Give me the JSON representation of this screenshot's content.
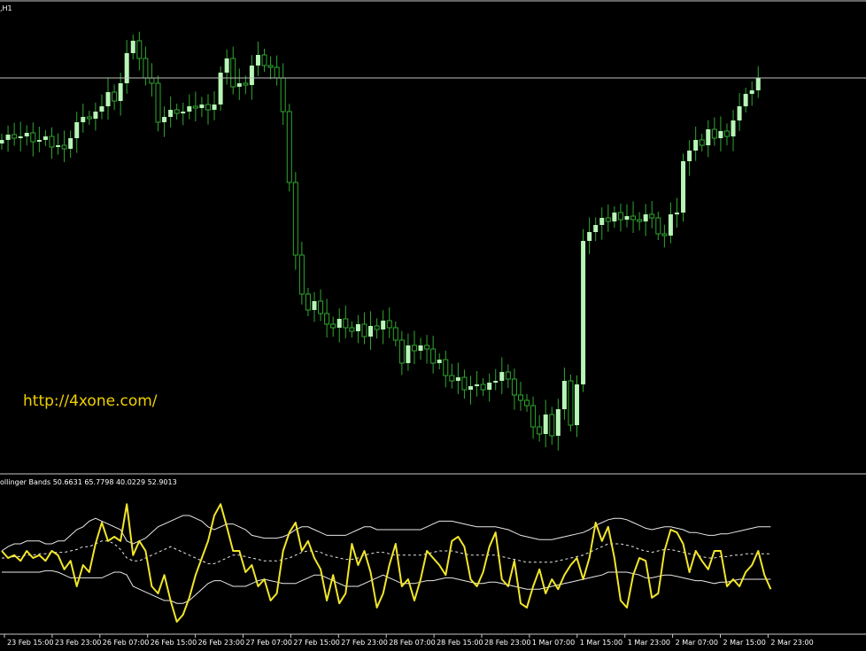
{
  "window": {
    "symbol_label": ",H1",
    "url_text": "http://4xone.com/"
  },
  "colors": {
    "background": "#000000",
    "frame": "#c8c8c8",
    "bull_body": "#b8f5b8",
    "wick": "#2fa82f",
    "price_line": "#c0c0c0",
    "indicator_line": "#f2e62a",
    "band_line": "#e8e8e8",
    "url": "#f0d000"
  },
  "chart_data": [
    {
      "type": "candlestick",
      "timeframe": "H1",
      "y_reference": 1.0,
      "y_range": [
        0.0,
        1.0
      ],
      "closes": [
        0.36,
        0.39,
        0.37,
        0.38,
        0.4,
        0.35,
        0.36,
        0.38,
        0.32,
        0.33,
        0.31,
        0.37,
        0.46,
        0.49,
        0.48,
        0.52,
        0.55,
        0.63,
        0.58,
        0.68,
        0.85,
        0.92,
        0.82,
        0.71,
        0.68,
        0.46,
        0.49,
        0.53,
        0.51,
        0.52,
        0.55,
        0.54,
        0.56,
        0.53,
        0.56,
        0.74,
        0.82,
        0.66,
        0.68,
        0.67,
        0.78,
        0.84,
        0.78,
        0.77,
        0.71,
        0.52,
        0.12,
        -0.29,
        -0.51,
        -0.6,
        -0.55,
        -0.62,
        -0.68,
        -0.7,
        -0.65,
        -0.7,
        -0.72,
        -0.68,
        -0.75,
        -0.69,
        -0.71,
        -0.66,
        -0.7,
        -0.77,
        -0.9,
        -0.8,
        -0.83,
        -0.8,
        -0.82,
        -0.9,
        -0.88,
        -0.97,
        -1.0,
        -0.98,
        -1.05,
        -1.03,
        -1.02,
        -1.05,
        -1.01,
        -1.0,
        -0.95,
        -0.99,
        -1.08,
        -1.11,
        -1.14,
        -1.26,
        -1.3,
        -1.19,
        -1.31,
        -1.16,
        -1.0,
        -1.25,
        -1.02,
        -0.21,
        -0.16,
        -0.12,
        -0.08,
        -0.1,
        -0.05,
        -0.09,
        -0.07,
        -0.09,
        -0.1,
        -0.06,
        -0.08,
        -0.17,
        -0.18,
        -0.06,
        -0.05,
        0.24,
        0.3,
        0.36,
        0.33,
        0.42,
        0.37,
        0.41,
        0.38,
        0.47,
        0.55,
        0.62,
        0.64,
        0.71
      ],
      "price_line": 0.71,
      "watermark": "http://4xone.com/"
    },
    {
      "type": "line",
      "indicator": "Bollinger Bands",
      "header_text": "ollinger Bands 50.6631 65.7798 40.0229 52.9013",
      "x_tick_labels": [
        "23 Feb 15:00",
        "23 Feb 23:00",
        "26 Feb 07:00",
        "26 Feb 15:00",
        "26 Feb 23:00",
        "27 Feb 07:00",
        "27 Feb 15:00",
        "27 Feb 23:00",
        "28 Feb 07:00",
        "28 Feb 15:00",
        "28 Feb 23:00",
        "1 Mar 07:00",
        "1 Mar 15:00",
        "1 Mar 23:00",
        "2 Mar 07:00",
        "2 Mar 15:00",
        "2 Mar 23:00"
      ],
      "y_range": [
        0,
        100
      ],
      "series": [
        {
          "role": "oscillator",
          "values": [
            55,
            50,
            52,
            48,
            55,
            50,
            52,
            48,
            55,
            52,
            42,
            48,
            30,
            45,
            40,
            60,
            75,
            62,
            65,
            62,
            88,
            52,
            62,
            55,
            30,
            25,
            38,
            20,
            5,
            10,
            22,
            38,
            50,
            62,
            80,
            88,
            72,
            55,
            55,
            40,
            45,
            30,
            35,
            20,
            25,
            55,
            68,
            75,
            55,
            62,
            50,
            42,
            20,
            38,
            18,
            25,
            60,
            45,
            55,
            40,
            15,
            25,
            45,
            60,
            30,
            35,
            20,
            35,
            55,
            50,
            45,
            38,
            62,
            65,
            58,
            35,
            30,
            40,
            58,
            68,
            35,
            30,
            48,
            18,
            15,
            30,
            42,
            25,
            35,
            28,
            38,
            45,
            50,
            35,
            50,
            75,
            62,
            72,
            50,
            20,
            15,
            38,
            50,
            48,
            22,
            25,
            55,
            70,
            68,
            60,
            40,
            55,
            48,
            42,
            55,
            55,
            30,
            35,
            30,
            40,
            45,
            55,
            38,
            28
          ]
        },
        {
          "role": "upper_band",
          "values": [
            55,
            58,
            60,
            60,
            62,
            62,
            62,
            60,
            60,
            62,
            62,
            66,
            70,
            72,
            76,
            78,
            76,
            74,
            72,
            70,
            62,
            60,
            62,
            64,
            68,
            72,
            74,
            76,
            78,
            80,
            80,
            78,
            76,
            72,
            70,
            72,
            74,
            74,
            72,
            70,
            66,
            65,
            64,
            64,
            64,
            65,
            67,
            70,
            72,
            72,
            70,
            68,
            66,
            66,
            66,
            66,
            68,
            70,
            72,
            72,
            70,
            70,
            70,
            70,
            70,
            70,
            70,
            70,
            72,
            74,
            76,
            76,
            76,
            75,
            74,
            73,
            72,
            72,
            72,
            72,
            71,
            70,
            68,
            66,
            65,
            64,
            63,
            63,
            63,
            64,
            65,
            66,
            67,
            68,
            70,
            73,
            75,
            77,
            78,
            78,
            77,
            75,
            73,
            71,
            70,
            71,
            72,
            72,
            71,
            70,
            68,
            68,
            67,
            66,
            66,
            67,
            67,
            68,
            69,
            70,
            71,
            72,
            72,
            72
          ]
        },
        {
          "role": "middle_band",
          "values": [
            50,
            50,
            51,
            51,
            52,
            52,
            53,
            53,
            54,
            54,
            54,
            55,
            56,
            58,
            58,
            60,
            62,
            62,
            60,
            56,
            50,
            48,
            48,
            50,
            52,
            54,
            56,
            58,
            56,
            54,
            52,
            50,
            48,
            46,
            46,
            48,
            50,
            52,
            52,
            51,
            50,
            49,
            48,
            48,
            48,
            49,
            50,
            52,
            54,
            55,
            55,
            54,
            52,
            51,
            50,
            49,
            49,
            50,
            52,
            53,
            54,
            54,
            53,
            52,
            52,
            52,
            52,
            52,
            53,
            54,
            55,
            55,
            55,
            54,
            53,
            52,
            52,
            52,
            52,
            52,
            51,
            50,
            49,
            48,
            47,
            47,
            47,
            47,
            47,
            48,
            49,
            50,
            51,
            52,
            54,
            56,
            58,
            60,
            60,
            60,
            59,
            58,
            56,
            55,
            54,
            55,
            56,
            56,
            55,
            54,
            53,
            52,
            51,
            50,
            50,
            51,
            51,
            52,
            52,
            53,
            53,
            53,
            53,
            53
          ]
        },
        {
          "role": "lower_band",
          "values": [
            40,
            40,
            40,
            40,
            40,
            40,
            40,
            41,
            41,
            40,
            38,
            36,
            36,
            36,
            36,
            36,
            36,
            38,
            40,
            40,
            38,
            30,
            28,
            26,
            24,
            22,
            20,
            20,
            18,
            18,
            20,
            24,
            28,
            32,
            34,
            34,
            32,
            30,
            30,
            30,
            32,
            34,
            35,
            34,
            33,
            32,
            32,
            32,
            34,
            36,
            38,
            38,
            36,
            34,
            32,
            30,
            30,
            30,
            32,
            34,
            36,
            38,
            36,
            34,
            32,
            32,
            32,
            33,
            34,
            34,
            35,
            36,
            36,
            35,
            34,
            33,
            32,
            32,
            33,
            33,
            32,
            31,
            30,
            29,
            28,
            28,
            28,
            29,
            30,
            31,
            32,
            33,
            34,
            35,
            36,
            37,
            38,
            40,
            40,
            40,
            40,
            39,
            38,
            36,
            36,
            37,
            38,
            38,
            37,
            36,
            35,
            34,
            34,
            33,
            32,
            33,
            33,
            34,
            35,
            35,
            35,
            35,
            35,
            35
          ]
        }
      ]
    }
  ]
}
